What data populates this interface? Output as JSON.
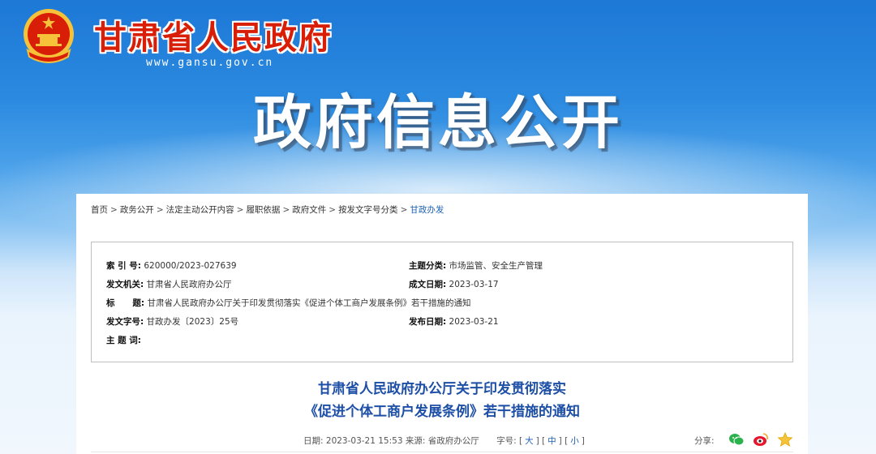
{
  "header": {
    "site_name": "甘肃省人民政府",
    "site_url": "www.gansu.gov.cn",
    "banner_title": "政府信息公开",
    "colors": {
      "brand_red": "#d81e06",
      "link_blue": "#1a5fb4",
      "title_blue": "#1d4fa6"
    }
  },
  "breadcrumb": {
    "items": [
      "首页",
      "政务公开",
      "法定主动公开内容",
      "履职依据",
      "政府文件",
      "按发文字号分类",
      "甘政办发"
    ],
    "separator": ">"
  },
  "meta": {
    "index_label": "索 引 号:",
    "index_value": "620000/2023-027639",
    "topic_label": "主题分类:",
    "topic_value": "市场监管、安全生产管理",
    "issuer_label": "发文机关:",
    "issuer_value": "甘肃省人民政府办公厅",
    "written_label": "成文日期:",
    "written_value": "2023-03-17",
    "title_label": "标      题:",
    "title_value": "甘肃省人民政府办公厅关于印发贯彻落实《促进个体工商户发展条例》若干措施的通知",
    "docno_label": "发文字号:",
    "docno_value": "甘政办发〔2023〕25号",
    "published_label": "发布日期:",
    "published_value": "2023-03-21",
    "keywords_label": "主 题 词:",
    "keywords_value": ""
  },
  "document": {
    "title_line1": "甘肃省人民政府办公厅关于印发贯彻落实",
    "title_line2": "《促进个体工商户发展条例》若干措施的通知",
    "date_label": "日期:",
    "date_value": "2023-03-21 15:53",
    "source_label": "来源:",
    "source_value": "省政府办公厅",
    "fontsize_label": "字号:",
    "font_sizes": [
      "大",
      "中",
      "小"
    ],
    "share_label": "分享:",
    "share_icons": [
      "wechat-icon",
      "weibo-icon",
      "favorite-star-icon"
    ]
  }
}
